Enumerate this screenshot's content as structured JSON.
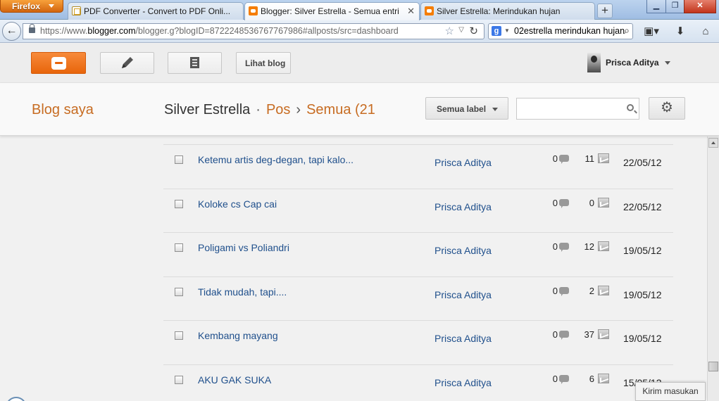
{
  "browser": {
    "menu_label": "Firefox",
    "tabs": [
      {
        "title": "PDF Converter - Convert to PDF Onli...",
        "favicon": "pdf-icon"
      },
      {
        "title": "Blogger: Silver Estrella - Semua entri",
        "favicon": "blogger-icon",
        "active": true
      },
      {
        "title": "Silver Estrella: Merindukan hujan",
        "favicon": "blogger-icon"
      }
    ],
    "url_prefix": "https://www.",
    "url_host": "blogger.com",
    "url_path": "/blogger.g?blogID=8722248536767767986#allposts/src=dashboard",
    "search_value": "02estrella merindukan hujan",
    "search_engine_letter": "g"
  },
  "topbar": {
    "view_blog_label": "Lihat blog",
    "user_name": "Prisca Aditya"
  },
  "header": {
    "my_blogs": "Blog saya",
    "blog_name": "Silver Estrella",
    "sep1": "·",
    "posts": "Pos",
    "sep2": "›",
    "all": "Semua (21",
    "label_filter": "Semua label",
    "search_placeholder": ""
  },
  "posts": [
    {
      "title": "Ketemu artis deg-degan, tapi kalo...",
      "author": "Prisca Aditya",
      "comments": "0",
      "views": "11",
      "date": "22/05/12"
    },
    {
      "title": "Koloke cs Cap cai",
      "author": "Prisca Aditya",
      "comments": "0",
      "views": "0",
      "date": "22/05/12"
    },
    {
      "title": "Poligami vs Poliandri",
      "author": "Prisca Aditya",
      "comments": "0",
      "views": "12",
      "date": "19/05/12"
    },
    {
      "title": "Tidak mudah, tapi....",
      "author": "Prisca Aditya",
      "comments": "0",
      "views": "2",
      "date": "19/05/12"
    },
    {
      "title": "Kembang mayang",
      "author": "Prisca Aditya",
      "comments": "0",
      "views": "37",
      "date": "19/05/12"
    },
    {
      "title": "AKU GAK SUKA",
      "author": "Prisca Aditya",
      "comments": "0",
      "views": "6",
      "date": "15/05/12"
    }
  ],
  "feedback_label": "Kirim masukan",
  "colors": {
    "brand_orange": "#f57d00",
    "breadcrumb_orange": "#c76c22",
    "link_blue": "#20508c"
  }
}
